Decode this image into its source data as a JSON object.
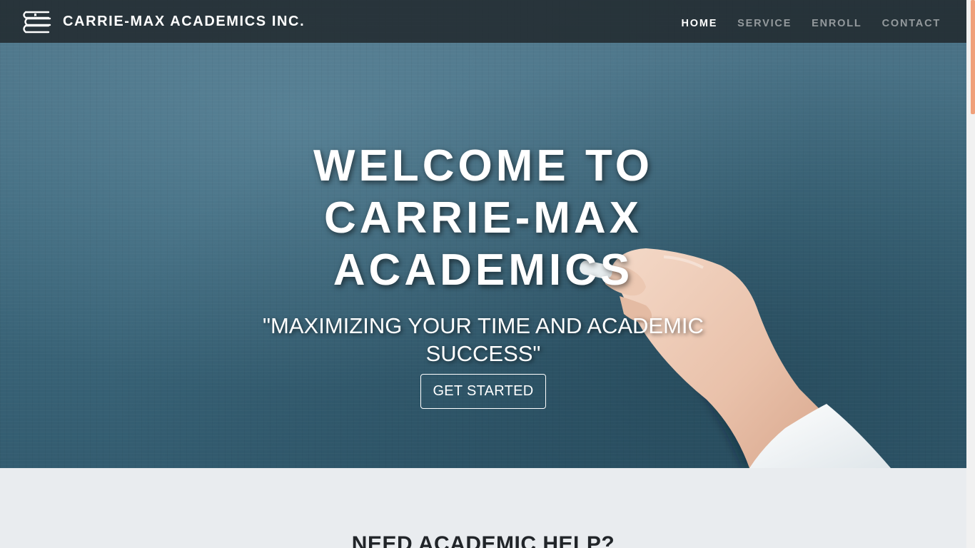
{
  "navbar": {
    "brand": "CARRIE-MAX ACADEMICS INC.",
    "links": [
      {
        "label": "HOME",
        "active": true
      },
      {
        "label": "SERVICE",
        "active": false
      },
      {
        "label": "ENROLL",
        "active": false
      },
      {
        "label": "CONTACT",
        "active": false
      }
    ]
  },
  "hero": {
    "title": "WELCOME TO CARRIE-MAX ACADEMICS",
    "subtitle": "\"MAXIMIZING YOUR TIME AND ACADEMIC SUCCESS\"",
    "cta_label": "GET STARTED"
  },
  "section": {
    "heading": "NEED ACADEMIC HELP?"
  },
  "colors": {
    "navbar_bg": "#1e2428",
    "chalkboard": "#3f6a7e",
    "section_bg": "#e9ecef",
    "scroll_thumb": "#f0a07a"
  },
  "icons": {
    "logo": "books-stack-icon"
  }
}
